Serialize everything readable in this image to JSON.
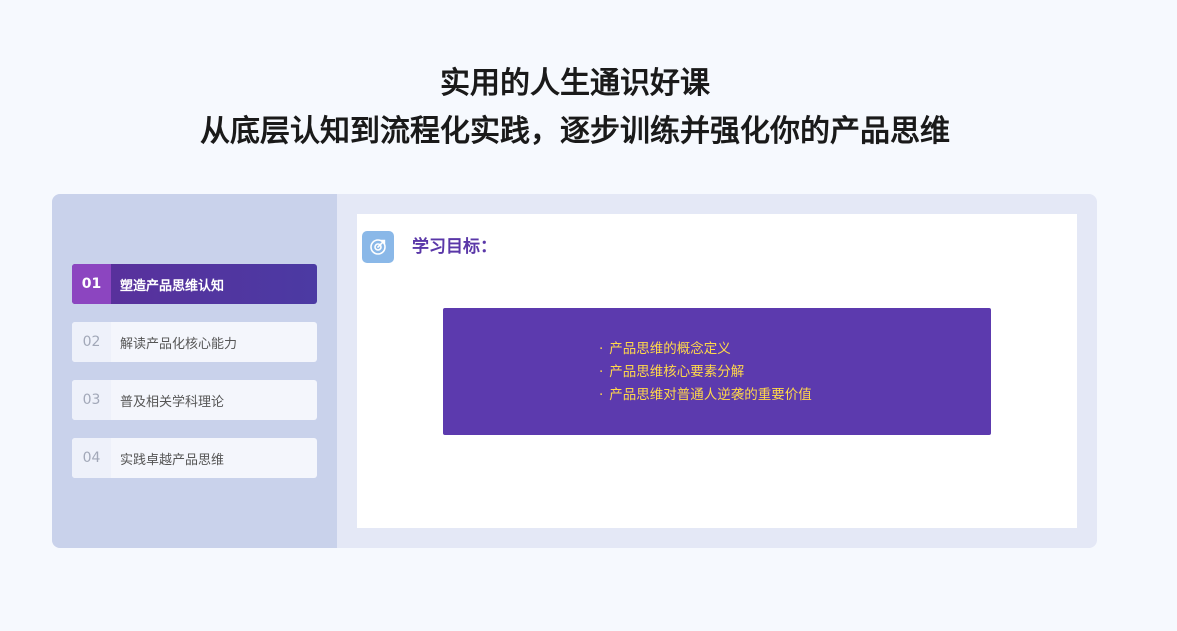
{
  "header": {
    "line1": "实用的人生通识好课",
    "line2": "从底层认知到流程化实践，逐步训练并强化你的产品思维"
  },
  "sidebar": {
    "items": [
      {
        "num": "01",
        "label": "塑造产品思维认知",
        "active": true
      },
      {
        "num": "02",
        "label": "解读产品化核心能力",
        "active": false
      },
      {
        "num": "03",
        "label": "普及相关学科理论",
        "active": false
      },
      {
        "num": "04",
        "label": "实践卓越产品思维",
        "active": false
      }
    ]
  },
  "panel": {
    "icon": "target-icon",
    "title": "学习目标：",
    "bullet": "·",
    "goals": [
      "产品思维的概念定义",
      "产品思维核心要素分解",
      "产品思维对普通人逆袭的重要价值"
    ]
  },
  "colors": {
    "accent": "#5c3aae",
    "active_num": "#8c45c0",
    "goal_text": "#ffd84a",
    "sidebar_bg": "#c9d2eb",
    "page_bg": "#f6f9fe"
  }
}
